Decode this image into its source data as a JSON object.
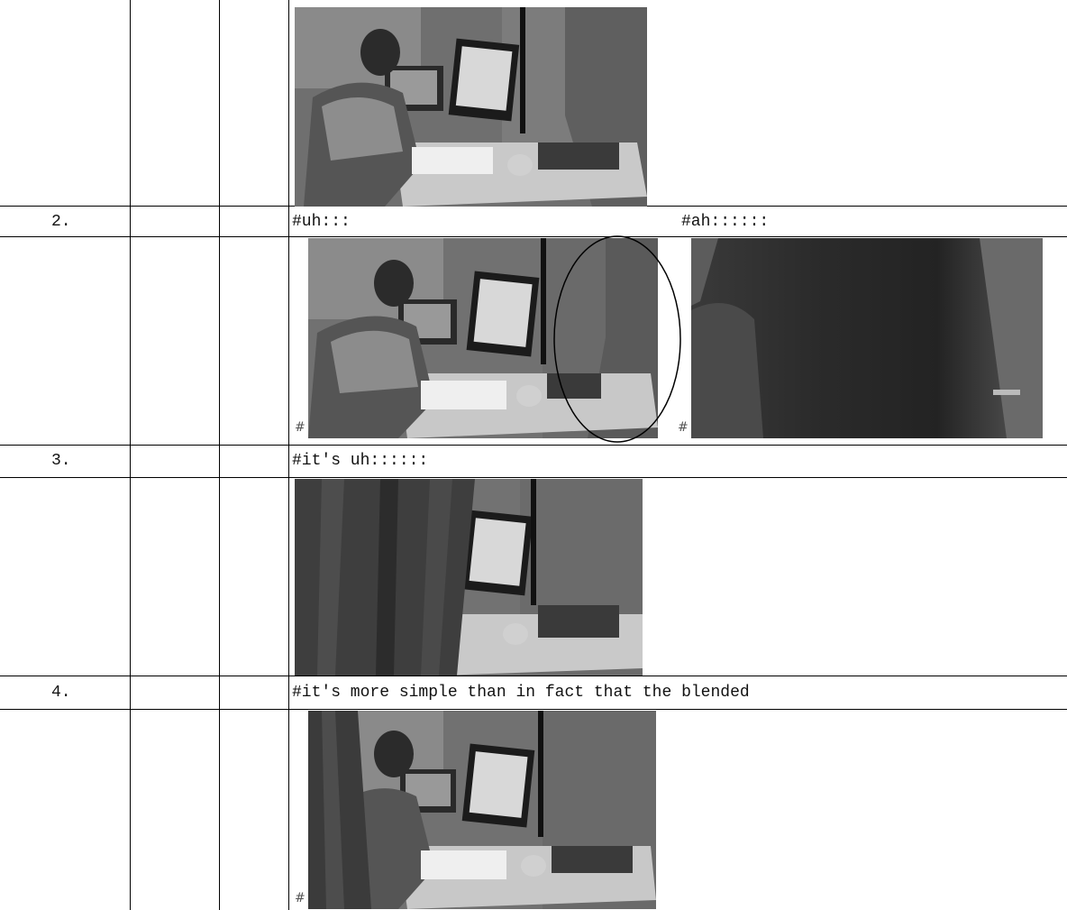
{
  "rows": [
    {
      "number": "2.",
      "utterance_a": "#uh:::",
      "utterance_b": "#ah::::::"
    },
    {
      "number": "3.",
      "utterance_a": "#it's uh::::::"
    },
    {
      "number": "4.",
      "utterance_a": "#it's more simple than in fact that the blended"
    }
  ],
  "frame_marker": "#"
}
